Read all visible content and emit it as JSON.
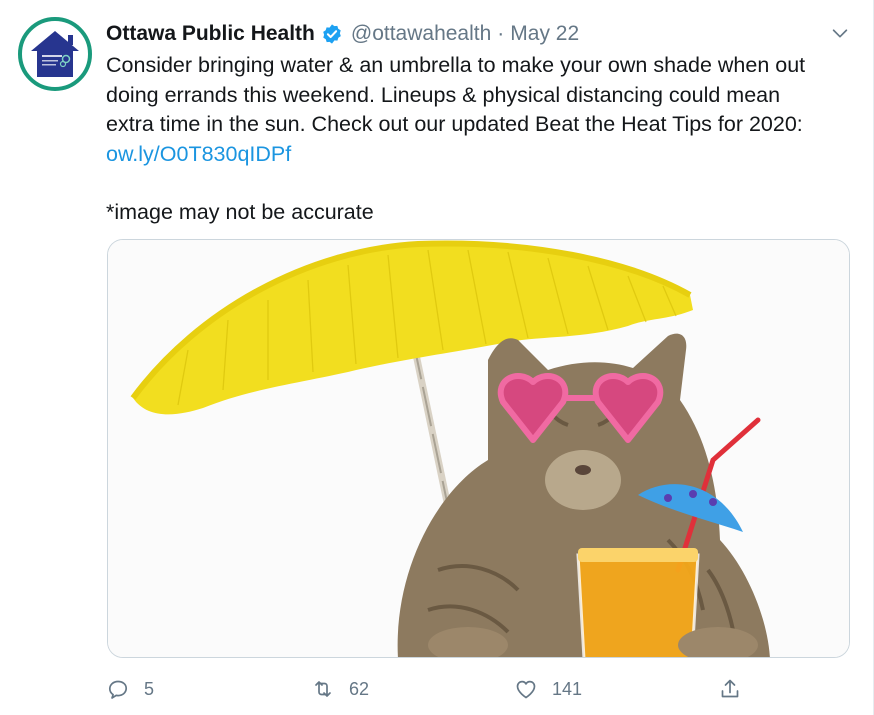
{
  "tweet": {
    "author_name": "Ottawa Public Health",
    "handle": "@ottawahealth",
    "separator": "·",
    "date": "May 22",
    "text_line1": "Consider bringing water & an umbrella to make your own shade when out",
    "text_line2": "doing errands this weekend.  Lineups & physical distancing could mean",
    "text_line3": "extra time in the sun. Check out our updated Beat the Heat Tips for 2020:",
    "link": "ow.ly/O0T830qIDPf",
    "note": "*image may not be accurate"
  },
  "actions": {
    "replies": "5",
    "retweets": "62",
    "likes": "141"
  },
  "icons": {
    "avatar": "ottawa-house-logo",
    "verified": "verified-badge-icon",
    "caret": "chevron-down-icon",
    "reply": "reply-icon",
    "retweet": "retweet-icon",
    "like": "heart-icon",
    "share": "share-icon"
  },
  "colors": {
    "verified_blue": "#1da1f2",
    "link_blue": "#1b95e0",
    "avatar_ring": "#1a9a7c",
    "muted_text": "#657786"
  }
}
